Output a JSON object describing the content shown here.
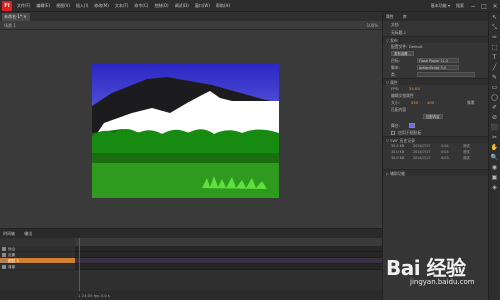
{
  "menubar": {
    "logo": "Fl",
    "items": [
      "文件(F)",
      "编辑(E)",
      "视图(V)",
      "插入(I)",
      "修改(M)",
      "文本(T)",
      "命令(C)",
      "控制(O)",
      "调试(D)",
      "窗口(W)",
      "帮助(H)"
    ],
    "right_labels": [
      "基本功能 ▾",
      "搜索"
    ],
    "window_buttons": [
      "−",
      "□",
      "✕"
    ]
  },
  "document": {
    "tab": "未命名-1* ✕",
    "scene": "场景 1",
    "zoom": "100%"
  },
  "timeline": {
    "tabs": [
      "时间轴",
      "输出"
    ],
    "layers": [
      {
        "name": "远山",
        "selected": false
      },
      {
        "name": "近景",
        "selected": false
      },
      {
        "name": "图层 3",
        "selected": true
      },
      {
        "name": "背景",
        "selected": false
      }
    ],
    "ruler_marks": [
      "1",
      "5",
      "10",
      "15",
      "20",
      "25",
      "30",
      "35",
      "40",
      "45",
      "50",
      "55",
      "60",
      "65",
      "70"
    ],
    "status": "1   24.00 fps   0.0 s"
  },
  "panel": {
    "tabs": [
      "属性",
      "库"
    ],
    "doc_label": "文档",
    "doc_name": "无标题-1",
    "sections": {
      "publish": "▽ 发布",
      "properties": "▽ 属性",
      "swf_history": "▽ SWF 历史记录",
      "accessibility": "▷ 辅助功能"
    },
    "profile_label": "配置文件:",
    "profile_value": "Default",
    "publish_settings": "发布设置...",
    "target_label": "目标:",
    "target_value": "Flash Player 11.2",
    "script_label": "脚本:",
    "script_value": "ActionScript 3.0",
    "class_label": "类:",
    "fps_label": "FPS:",
    "fps_value": "24.00",
    "edit_doc_props": "编辑文档属性",
    "size_label": "大小:",
    "size_w": "550",
    "size_h": "400",
    "size_unit": "像素",
    "match_content": "匹配内容",
    "stage_label": "舞台:",
    "stage_color": "#6666ff",
    "apply_to_pasteboard": "应用于粘贴板",
    "history": [
      {
        "size": "35.2 KB",
        "date": "2014/7/17",
        "time": "0:04",
        "action": "测试"
      },
      {
        "size": "35.0 KB",
        "date": "2014/7/17",
        "time": "0:04",
        "action": "测试"
      },
      {
        "size": "35.0 KB",
        "date": "2014/7/17",
        "time": "0:03",
        "action": "测试"
      }
    ]
  },
  "tools": [
    "↖",
    "⤡",
    "✑",
    "⬚",
    "T",
    "╱",
    "✎",
    "▭",
    "◯",
    "✐",
    "⊘",
    "⬛",
    "✂",
    "✋",
    "🔍",
    "◉",
    "▣",
    "◈"
  ],
  "watermark": {
    "brand": "Bai 经验",
    "url": "jingyan.baidu.com"
  }
}
